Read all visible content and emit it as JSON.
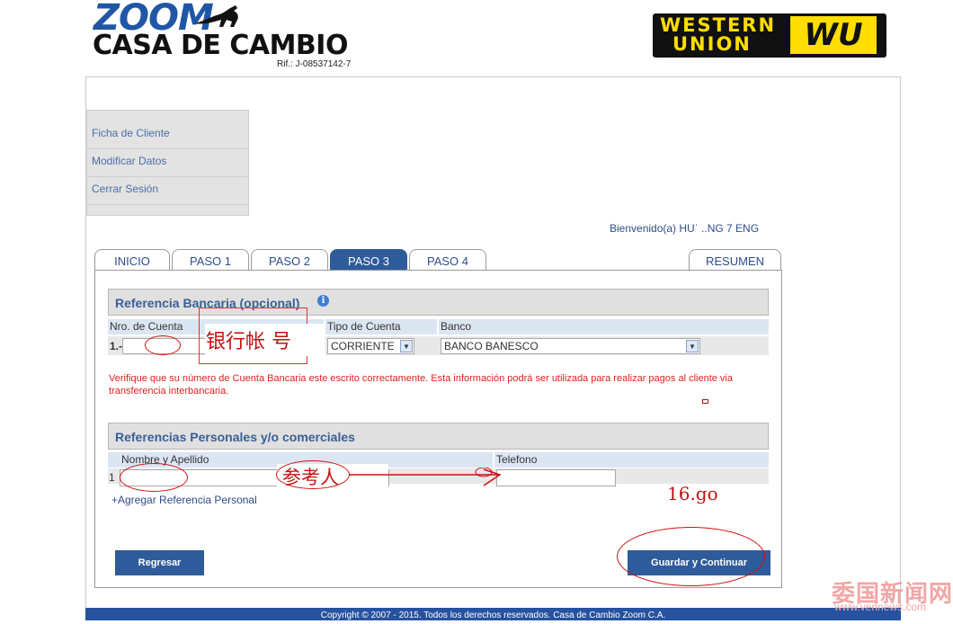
{
  "header": {
    "logo_zoom": "ZOOM",
    "logo_casa": "CASA DE CAMBIO",
    "rif": "Rif.: J-08537142-7",
    "wu_line1": "WESTERN",
    "wu_line2": "UNION",
    "wu_badge": "WU"
  },
  "sidebar": {
    "items": [
      {
        "label": "Ficha de Cliente"
      },
      {
        "label": "Modificar Datos"
      },
      {
        "label": "Cerrar Sesión"
      }
    ]
  },
  "welcome": "Bienvenido(a) HUˈ ..NG 7 ENG",
  "tabs": [
    {
      "label": "INICIO",
      "active": false
    },
    {
      "label": "PASO 1",
      "active": false
    },
    {
      "label": "PASO 2",
      "active": false
    },
    {
      "label": "PASO 3",
      "active": true
    },
    {
      "label": "PASO 4",
      "active": false
    },
    {
      "label": "RESUMEN",
      "active": false
    }
  ],
  "bank_section": {
    "title": "Referencia Bancaria (opcional)",
    "info_icon": "info-icon",
    "col_account": "Nro. de Cuenta",
    "col_type": "Tipo de Cuenta",
    "col_bank": "Banco",
    "row_index": "1.-",
    "account_value": "",
    "type_value": "CORRIENTE",
    "bank_value": "BANCO BANESCO",
    "warning": "Verifique que su número de Cuenta Bancaria este escrito correctamente. Esta información podrá ser utilizada para realizar pagos al cliente via transferencia interbancaria."
  },
  "ref_section": {
    "title": "Referencias Personales y/o comerciales",
    "col_name": "Nombre y Apellido",
    "col_phone": "Telefono",
    "row_index": "1",
    "name_value": "",
    "phone_value": "",
    "add_link": "+Agregar Referencia Personal"
  },
  "buttons": {
    "back": "Regresar",
    "save": "Guardar y Continuar"
  },
  "footer": "Copyright © 2007 - 2015. Todos los derechos reservados. Casa de Cambio Zoom C.A.",
  "annotations": {
    "bank_account_note": "银行帐 号",
    "reference_note": "参考人",
    "note_16go": "16.go"
  },
  "watermark": {
    "main": "委国新闻网",
    "url": "www.vennews.com"
  },
  "colors": {
    "brand_blue": "#2e5b9a",
    "wu_yellow": "#ffdd00",
    "warning_red": "#e02020",
    "annotation_red": "#c81010"
  }
}
